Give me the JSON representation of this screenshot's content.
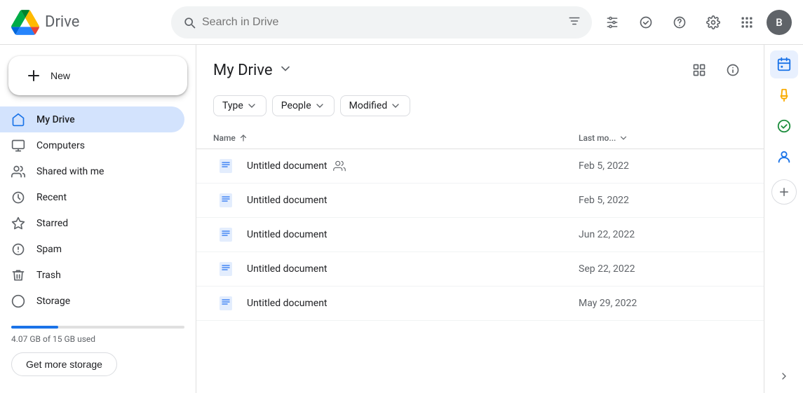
{
  "app": {
    "name": "Drive",
    "title": "My Drive"
  },
  "header": {
    "search_placeholder": "Search in Drive",
    "user_initial": "B"
  },
  "sidebar": {
    "new_label": "New",
    "nav_items": [
      {
        "id": "my-drive",
        "label": "My Drive",
        "active": true
      },
      {
        "id": "computers",
        "label": "Computers",
        "active": false
      },
      {
        "id": "shared-with-me",
        "label": "Shared with me",
        "active": false
      },
      {
        "id": "recent",
        "label": "Recent",
        "active": false
      },
      {
        "id": "starred",
        "label": "Starred",
        "active": false
      },
      {
        "id": "spam",
        "label": "Spam",
        "active": false
      },
      {
        "id": "trash",
        "label": "Trash",
        "active": false
      },
      {
        "id": "storage",
        "label": "Storage",
        "active": false
      }
    ],
    "storage_text": "4.07 GB of 15 GB used",
    "get_more_storage_label": "Get more storage"
  },
  "main": {
    "title": "My Drive",
    "filters": [
      {
        "id": "type",
        "label": "Type",
        "has_chevron": true
      },
      {
        "id": "people",
        "label": "People",
        "has_chevron": true
      },
      {
        "id": "modified",
        "label": "Modified",
        "has_chevron": true
      }
    ],
    "columns": {
      "name_label": "Name",
      "date_label": "Last mo..."
    },
    "files": [
      {
        "id": 1,
        "name": "Untitled document",
        "date": "Feb 5, 2022",
        "shared": true
      },
      {
        "id": 2,
        "name": "Untitled document",
        "date": "Feb 5, 2022",
        "shared": false
      },
      {
        "id": 3,
        "name": "Untitled document",
        "date": "Jun 22, 2022",
        "shared": false
      },
      {
        "id": 4,
        "name": "Untitled document",
        "date": "Sep 22, 2022",
        "shared": false
      },
      {
        "id": 5,
        "name": "Untitled document",
        "date": "May 29, 2022",
        "shared": false
      }
    ]
  },
  "right_panel": {
    "icons": [
      "calendar",
      "keep",
      "tasks",
      "contacts",
      "add"
    ]
  }
}
